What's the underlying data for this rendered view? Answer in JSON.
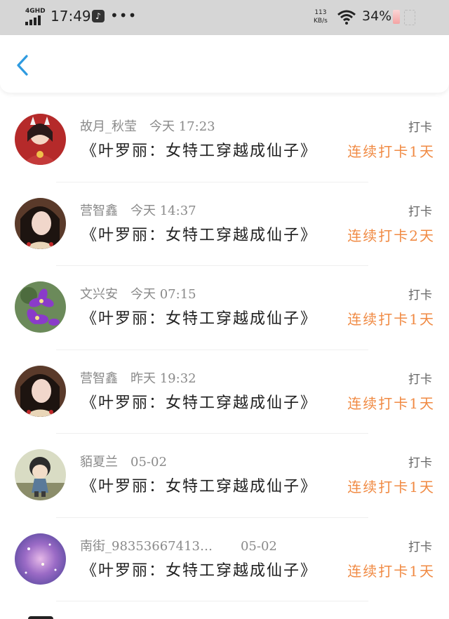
{
  "status_bar": {
    "network": "4GHD",
    "time": "17:49",
    "speed_value": "113",
    "speed_unit": "KB/s",
    "battery": "34%"
  },
  "header": {
    "back_icon": "chevron-left-icon"
  },
  "colors": {
    "accent": "#2f9be0",
    "streak": "#f08a43",
    "statusbar": "#d6d6d6"
  },
  "records": [
    {
      "user": "故月_秋莹",
      "time": "今天 17:23",
      "book": "《叶罗丽：女特工穿越成仙子》",
      "tag": "打卡",
      "streak": "连续打卡1天",
      "avatar": "anime-girl-avatar"
    },
    {
      "user": "营智鑫",
      "time": "今天 14:37",
      "book": "《叶罗丽：女特工穿越成仙子》",
      "tag": "打卡",
      "streak": "连续打卡2天",
      "avatar": "portrait-avatar"
    },
    {
      "user": "文兴安",
      "time": "今天 07:15",
      "book": "《叶罗丽：女特工穿越成仙子》",
      "tag": "打卡",
      "streak": "连续打卡1天",
      "avatar": "flower-avatar"
    },
    {
      "user": "营智鑫",
      "time": "昨天 19:32",
      "book": "《叶罗丽：女特工穿越成仙子》",
      "tag": "打卡",
      "streak": "连续打卡1天",
      "avatar": "portrait-avatar"
    },
    {
      "user": "貊夏兰",
      "time": "05-02",
      "book": "《叶罗丽：女特工穿越成仙子》",
      "tag": "打卡",
      "streak": "连续打卡1天",
      "avatar": "doll-avatar"
    },
    {
      "user": "南街_98353667413…",
      "time": "05-02",
      "book": "《叶罗丽：女特工穿越成仙子》",
      "tag": "打卡",
      "streak": "连续打卡1天",
      "avatar": "galaxy-avatar"
    }
  ]
}
